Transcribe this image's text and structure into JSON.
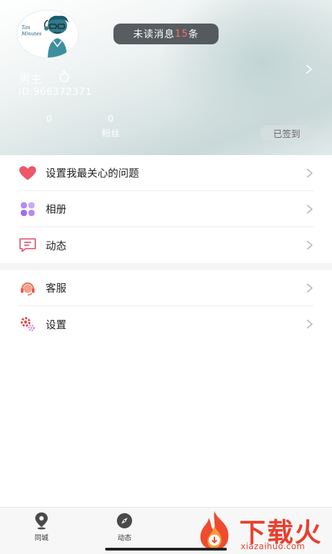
{
  "profile": {
    "avatar_text": "Tan Minutes",
    "nickname": "男主",
    "user_id": "ID:966372371",
    "unread": {
      "prefix": "未读消息",
      "count": "15",
      "suffix": "条"
    },
    "stats": [
      {
        "value": "0",
        "label": ""
      },
      {
        "value": "0",
        "label": "粉丝"
      }
    ],
    "signed_label": "已签到"
  },
  "menu_group_1": [
    {
      "label": "设置我最关心的问题",
      "icon": "heart-icon"
    },
    {
      "label": "相册",
      "icon": "album-grid-icon"
    },
    {
      "label": "动态",
      "icon": "message-bubble-icon"
    }
  ],
  "menu_group_2": [
    {
      "label": "客服",
      "icon": "customer-service-icon"
    },
    {
      "label": "设置",
      "icon": "settings-gear-icon"
    }
  ],
  "tabbar": [
    {
      "label": "同城",
      "icon": "location-pin-icon"
    },
    {
      "label": "动态",
      "icon": "compass-icon"
    }
  ],
  "watermark": {
    "main": "下载火",
    "sub": "xiazaihuo.com"
  },
  "colors": {
    "accent_red": "#ff6b6b",
    "heart": "#f0556a",
    "watermark": "#e8402e"
  }
}
